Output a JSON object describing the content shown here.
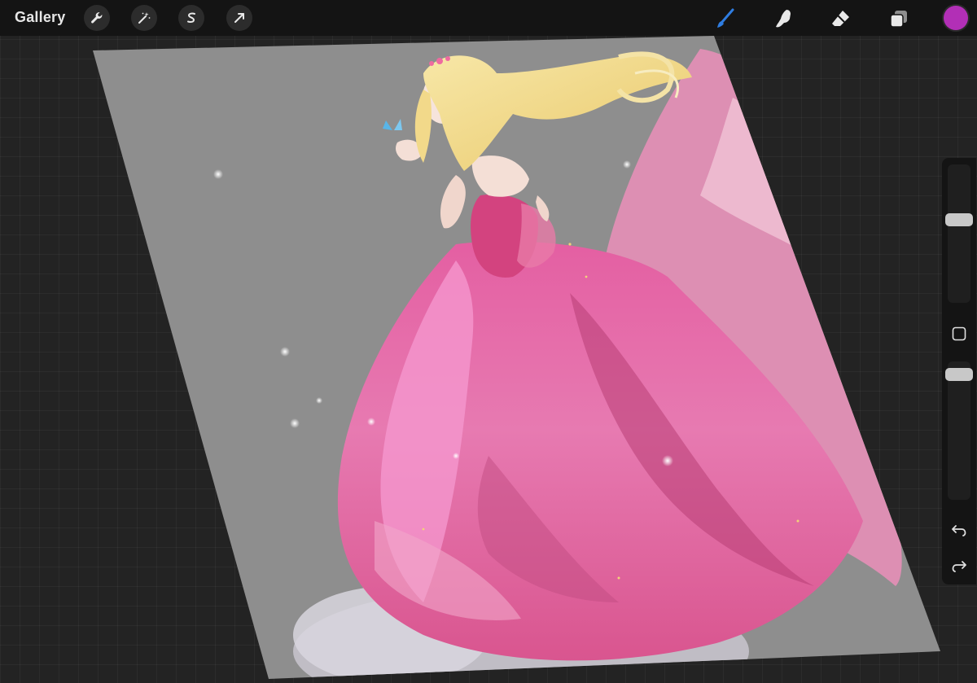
{
  "app": {
    "gallery_label": "Gallery",
    "accent_color": "#2f7de1",
    "current_color": "#b22fb6"
  },
  "toolbar_left": [
    {
      "name": "actions",
      "icon": "wrench-icon"
    },
    {
      "name": "adjustments",
      "icon": "magic-wand-icon"
    },
    {
      "name": "selection",
      "icon": "selection-s-icon"
    },
    {
      "name": "transform",
      "icon": "arrow-cursor-icon"
    }
  ],
  "toolbar_right": [
    {
      "name": "brush",
      "icon": "brush-icon",
      "active": true
    },
    {
      "name": "smudge",
      "icon": "smudge-finger-icon",
      "active": false
    },
    {
      "name": "eraser",
      "icon": "eraser-icon",
      "active": false
    },
    {
      "name": "layers",
      "icon": "layers-icon",
      "active": false
    },
    {
      "name": "colors",
      "icon": "color-swatch-icon",
      "active": false
    }
  ],
  "sidebar": {
    "brush_size_level": 0.35,
    "opacity_level": 0.95,
    "modify_icon": "square-modify-icon",
    "undo_icon": "undo-arrow-icon",
    "redo_icon": "redo-arrow-icon"
  },
  "canvas": {
    "background_color": "#8e8e8e",
    "dress_color": "#d9558f",
    "hair_color": "#f0dc90"
  }
}
